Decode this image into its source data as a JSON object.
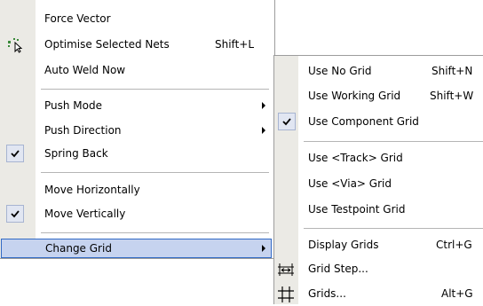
{
  "main_menu": {
    "items": [
      {
        "label": "Force Vector"
      },
      {
        "label": "Optimise Selected Nets",
        "shortcut": "Shift+L",
        "icon": "optimise-nets-icon"
      },
      {
        "label": "Auto Weld Now"
      },
      {
        "label": "Push Mode",
        "submenu": true
      },
      {
        "label": "Push Direction",
        "submenu": true
      },
      {
        "label": "Spring Back",
        "checked": true
      },
      {
        "label": "Move Horizontally"
      },
      {
        "label": "Move Vertically",
        "checked": true
      },
      {
        "label": "Change Grid",
        "submenu": true,
        "highlighted": true
      }
    ]
  },
  "grid_submenu": {
    "items": [
      {
        "label": "Use No Grid",
        "shortcut": "Shift+N"
      },
      {
        "label": "Use Working Grid",
        "shortcut": "Shift+W"
      },
      {
        "label": "Use Component Grid",
        "checked": true
      },
      {
        "label": "Use <Track> Grid"
      },
      {
        "label": "Use <Via> Grid"
      },
      {
        "label": "Use Testpoint Grid"
      },
      {
        "label": "Display Grids",
        "shortcut": "Ctrl+G"
      },
      {
        "label": "Grid Step...",
        "icon": "grid-step-icon"
      },
      {
        "label": "Grids...",
        "shortcut": "Alt+G",
        "icon": "grids-icon"
      }
    ]
  },
  "colors": {
    "gutter": "#ebeae5",
    "highlight": "#c6d3ef",
    "highlight_border": "#316ac5"
  }
}
